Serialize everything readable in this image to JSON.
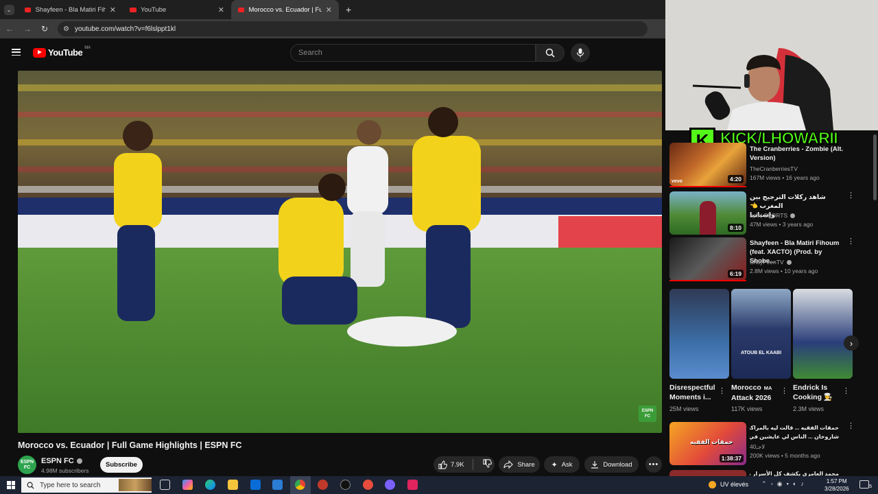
{
  "browser": {
    "tabs": [
      {
        "label": "Shayfeen - Bla Matiri Fihoum (f"
      },
      {
        "label": "YouTube"
      },
      {
        "label": "Morocco vs. Ecuador | Full Gam"
      }
    ],
    "url": "youtube.com/watch?v=f6lslppt1kl"
  },
  "youtube": {
    "logo": "YouTube",
    "region": "MA",
    "search_placeholder": "Search"
  },
  "video": {
    "title": "Morocco vs. Ecuador | Full Game Highlights | ESPN FC",
    "watermark": "ESPN FC",
    "channel": {
      "name": "ESPN FC",
      "subscribers": "4.98M subscribers",
      "avatar_text": "ESPN FC"
    },
    "subscribe_label": "Subscribe",
    "actions": {
      "likes": "7.9K",
      "share": "Share",
      "ask": "Ask",
      "download": "Download"
    }
  },
  "overlay": {
    "brand_letter": "K",
    "handle": "KICK/LHOWARII"
  },
  "sidebar": {
    "videos": [
      {
        "title_line1": "The Cranberries - Zombie (Alt.",
        "title_line2": "Version)",
        "channel": "TheCranberriesTV",
        "meta": "167M views • 16 years ago",
        "duration": "4:20",
        "thumb_tag": "vevo"
      },
      {
        "title_line1": "شاهد ركلات الترجيح بين المغرب 👈",
        "title_line2": "وإسبانيا",
        "channel": "beIN SPORTS",
        "meta": "47M views • 3 years ago",
        "duration": "8:10"
      },
      {
        "title_line1": "Shayfeen - Bla Matiri Fihoum",
        "title_line2": "(feat. XACTO) (Prod. by Shobe...",
        "channel": "ShayFeenTV",
        "meta": "2.8M views • 10 years ago",
        "duration": "6:19"
      }
    ],
    "shorts": [
      {
        "title_line1": "Disrespectful",
        "title_line2": "Moments i...",
        "views": "25M views"
      },
      {
        "title_line1": "Morocco",
        "title_badge": "MA",
        "title_line2": "Attack 2026",
        "views": "117K views",
        "thumb_text": "ATOUB EL KAABI"
      },
      {
        "title_line1": "Endrick Is",
        "title_line2": "Cooking 👨‍🍳",
        "views": "2.3M views"
      }
    ],
    "bottom_video": {
      "title_line1": "حمقات الفقيه ... قالت ليه بالمراكشية أنا بنت",
      "title_line2": "شاروخان ... الناس لي عايشين في أوروبا",
      "channel": "لاجـ40",
      "meta": "200K views • 5 months ago",
      "duration": "1:38:37",
      "thumb_text": "حمقات الفقيه"
    },
    "partial_title": "محمد العامري يكشف كل الأسرار بعد تعادل"
  },
  "taskbar": {
    "search_placeholder": "Type here to search",
    "weather": "UV élevés",
    "time": "1:57 PM",
    "date": "3/28/2026",
    "notifications": "5"
  },
  "colors": {
    "yt_red": "#ff0000",
    "kick_green": "#53fc18",
    "ecuador_yellow": "#f2d21b",
    "pitch": "#4f8a2f"
  }
}
